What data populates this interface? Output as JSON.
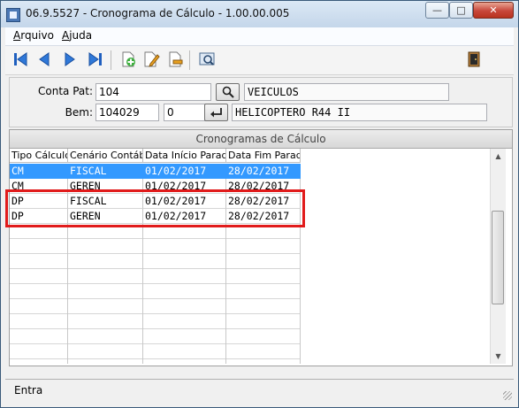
{
  "window": {
    "title": "06.9.5527 - Cronograma de Cálculo - 1.00.00.005",
    "minimize": "—",
    "maximize": "□",
    "close": "✕"
  },
  "menu": {
    "arquivo_first": "A",
    "arquivo_rest": "rquivo",
    "ajuda_first": "A",
    "ajuda_rest": "juda"
  },
  "toolbar": {
    "icons": [
      "first-record-icon",
      "previous-record-icon",
      "next-record-icon",
      "last-record-icon",
      "add-record-icon",
      "edit-record-icon",
      "delete-record-icon",
      "preview-icon",
      "exit-icon"
    ]
  },
  "form": {
    "conta_pat_label": "Conta Pat:",
    "conta_pat_value": "104",
    "conta_pat_desc": "VEICULOS",
    "bem_label": "Bem:",
    "bem_value": "104029",
    "bem_seq": "0",
    "bem_desc": "HELICOPTERO R44 II"
  },
  "grid": {
    "title": "Cronogramas de Cálculo",
    "columns": [
      "Tipo Cálculo",
      "Cenário Contábi",
      "Data Início Parada",
      "Data Fim Parada"
    ],
    "rows": [
      {
        "tipo": "CM",
        "cenario": "FISCAL",
        "inicio": "01/02/2017",
        "fim": "28/02/2017",
        "selected": true
      },
      {
        "tipo": "CM",
        "cenario": "GEREN",
        "inicio": "01/02/2017",
        "fim": "28/02/2017",
        "selected": false
      },
      {
        "tipo": "DP",
        "cenario": "FISCAL",
        "inicio": "01/02/2017",
        "fim": "28/02/2017",
        "selected": false
      },
      {
        "tipo": "DP",
        "cenario": "GEREN",
        "inicio": "01/02/2017",
        "fim": "28/02/2017",
        "selected": false
      }
    ]
  },
  "status": {
    "text": "Entra"
  },
  "colors": {
    "selection": "#3399ff",
    "highlight": "#e11b1b"
  }
}
